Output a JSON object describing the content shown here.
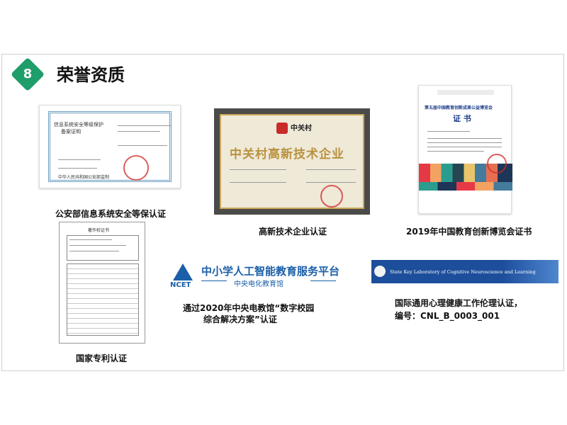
{
  "header": {
    "section_number": "8",
    "title": "荣誉资质"
  },
  "certificates": {
    "security": {
      "doc_title_line1": "信息系统安全等级保护",
      "doc_title_line2": "备案证明",
      "issuer": "中华人民共和国公安部监制",
      "caption": "公安部信息系统安全等保认证"
    },
    "hightech": {
      "logo_text": "中关村",
      "banner": "中关村高新技术企业",
      "caption": "高新技术企业认证"
    },
    "expo": {
      "title": "第五届中国教育创新成果公益博览会",
      "heading": "证 书",
      "caption": "2019年中国教育创新博览会证书"
    },
    "patent": {
      "header": "著作权证书",
      "caption": "国家专利认证"
    },
    "ncet": {
      "logo_text": "NCET",
      "platform_name": "中小学人工智能教育服务平台",
      "org_name": "中央电化教育馆",
      "caption_line1": "通过2020年中央电教馆“数字校园",
      "caption_line2": "综合解决方案”认证"
    },
    "ethics": {
      "banner_text": "State Key Laboratory of Cognitive Neuroscience and Learning",
      "caption_line1": "国际通用心理健康工作伦理认证，",
      "caption_line2": "编号：CNL_B_0003_001"
    }
  },
  "colors": {
    "accent_green": "#1f9d6a",
    "ncet_blue": "#1b5fa8",
    "banner_blue": "#1d4e9b",
    "gold": "#b8923f"
  }
}
